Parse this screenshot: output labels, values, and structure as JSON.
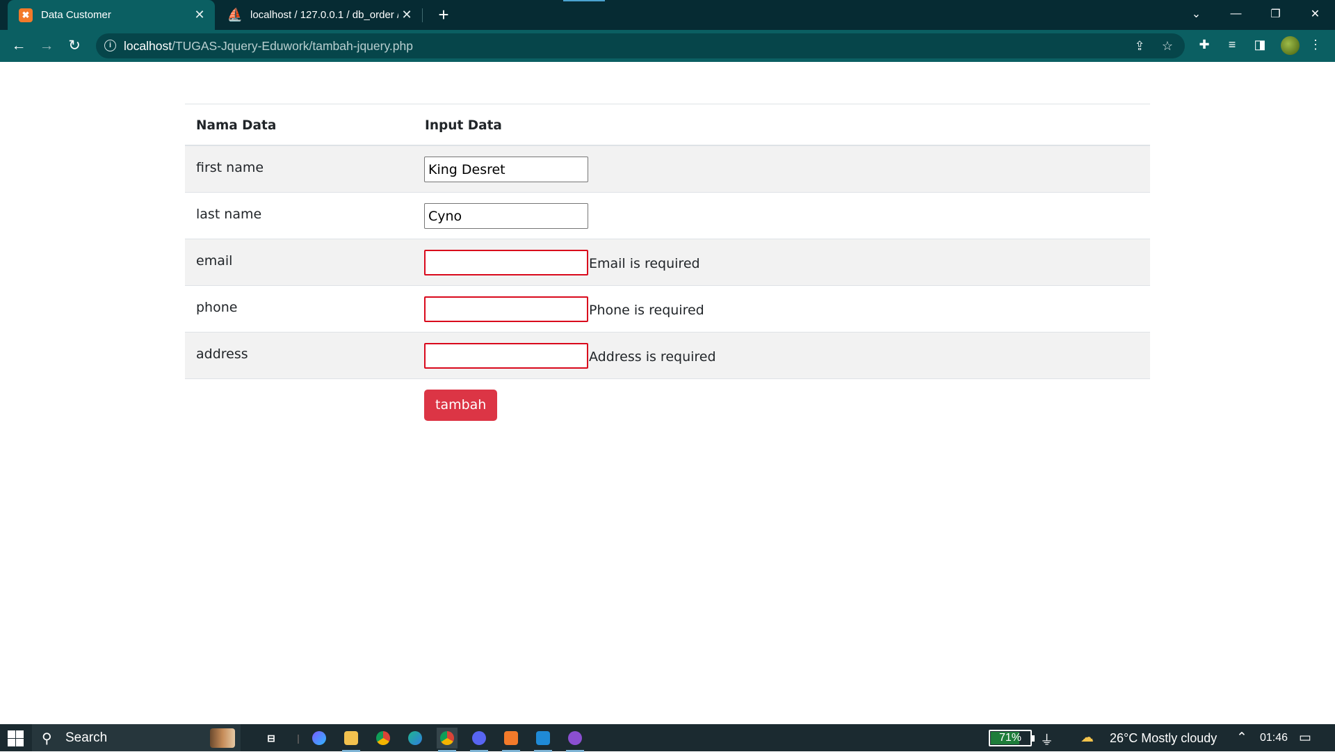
{
  "browser": {
    "tabs": [
      {
        "title": "Data Customer",
        "favicon": "xampp-icon",
        "active": true
      },
      {
        "title": "localhost / 127.0.0.1 / db_order /",
        "favicon": "phpmyadmin-icon",
        "active": false
      }
    ],
    "address": {
      "host": "localhost",
      "path": "/TUGAS-Jquery-Eduwork/tambah-jquery.php"
    }
  },
  "table": {
    "headers": [
      "Nama Data",
      "Input Data"
    ],
    "rows": [
      {
        "label": "first name",
        "value": "King Desret",
        "error": ""
      },
      {
        "label": "last name",
        "value": "Cyno",
        "error": ""
      },
      {
        "label": "email",
        "value": "",
        "error": "Email is required"
      },
      {
        "label": "phone",
        "value": "",
        "error": "Phone is required"
      },
      {
        "label": "address",
        "value": "",
        "error": "Address is required"
      }
    ],
    "submit_label": "tambah"
  },
  "taskbar": {
    "search_label": "Search",
    "battery_percent": "71%",
    "battery_level": 0.71,
    "weather": "26°C  Mostly cloudy",
    "time": "01:46"
  },
  "colors": {
    "browser_frame": "#062b33",
    "browser_toolbar": "#0b5f62",
    "error_border": "#d9091c",
    "button": "#dc3545"
  }
}
